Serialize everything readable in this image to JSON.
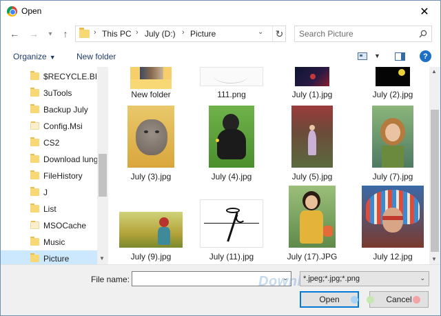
{
  "window": {
    "title": "Open",
    "close": "✕"
  },
  "nav": {
    "back": "←",
    "forward": "→",
    "recent": "▾",
    "up": "↑"
  },
  "address": {
    "crumbs": [
      "This PC",
      "July (D:)",
      "Picture"
    ],
    "refresh": "↻"
  },
  "search": {
    "placeholder": "Search Picture"
  },
  "toolbar": {
    "organize": "Organize",
    "new_folder": "New folder",
    "help": "?"
  },
  "sidebar": {
    "items": [
      {
        "label": "$RECYCLE.BIN",
        "pale": false
      },
      {
        "label": "3uTools",
        "pale": false
      },
      {
        "label": "Backup July",
        "pale": false
      },
      {
        "label": "Config.Msi",
        "pale": true
      },
      {
        "label": "CS2",
        "pale": false
      },
      {
        "label": "Download lung",
        "pale": false
      },
      {
        "label": "FileHistory",
        "pale": false
      },
      {
        "label": "J",
        "pale": false
      },
      {
        "label": "List",
        "pale": false
      },
      {
        "label": "MSOCache",
        "pale": true
      },
      {
        "label": "Music",
        "pale": false
      },
      {
        "label": "Picture",
        "pale": false,
        "selected": true
      }
    ]
  },
  "files": [
    {
      "name": "New folder",
      "kind": "folder"
    },
    {
      "name": "111.png",
      "kind": "sketch"
    },
    {
      "name": "July (1).jpg",
      "kind": "dark"
    },
    {
      "name": "July (2).jpg",
      "kind": "night"
    },
    {
      "name": "July (3).jpg",
      "kind": "kitten"
    },
    {
      "name": "July (4).jpg",
      "kind": "gorilla"
    },
    {
      "name": "July (5).jpg",
      "kind": "forest"
    },
    {
      "name": "July (7).jpg",
      "kind": "girl"
    },
    {
      "name": "July (9).jpg",
      "kind": "field"
    },
    {
      "name": "July (11).jpg",
      "kind": "logo"
    },
    {
      "name": "July (17).JPG",
      "kind": "child"
    },
    {
      "name": "July 12.jpg",
      "kind": "headdress"
    }
  ],
  "bottom": {
    "file_name_label": "File name:",
    "file_name_value": "",
    "file_type": "*.jpeg;*.jpg;*.png",
    "open_label": "Open",
    "cancel_label": "Cancel",
    "watermark": "Download.com.vn"
  }
}
